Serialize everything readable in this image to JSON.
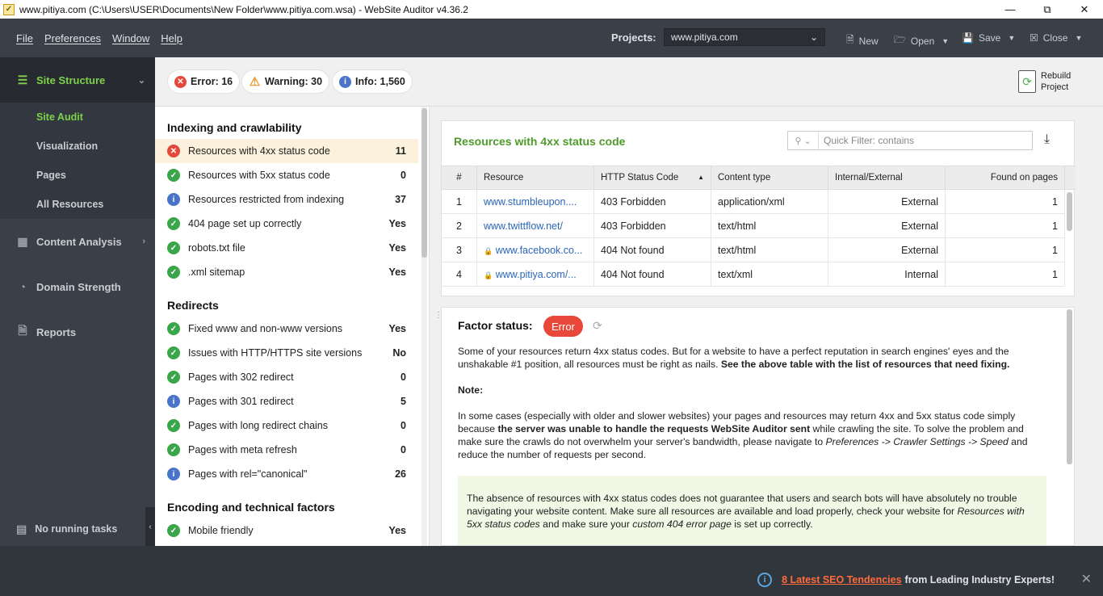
{
  "window": {
    "title": "www.pitiya.com (C:\\Users\\USER\\Documents\\New Folder\\www.pitiya.com.wsa) - WebSite Auditor v4.36.2"
  },
  "menu": [
    "File",
    "Preferences",
    "Window",
    "Help"
  ],
  "toolbar": {
    "projects_label": "Projects:",
    "project_value": "www.pitiya.com",
    "new_label": "New",
    "open_label": "Open",
    "save_label": "Save",
    "close_label": "Close"
  },
  "sidebar": {
    "site_structure": "Site Structure",
    "sub": [
      "Site Audit",
      "Visualization",
      "Pages",
      "All Resources"
    ],
    "content_analysis": "Content Analysis",
    "domain_strength": "Domain Strength",
    "reports": "Reports",
    "tasks": "No running tasks"
  },
  "summary": {
    "error": "Error: 16",
    "warning": "Warning: 30",
    "info": "Info: 1,560"
  },
  "rebuild": {
    "line1": "Rebuild",
    "line2": "Project"
  },
  "groups": [
    {
      "title": "Indexing and crawlability",
      "items": [
        {
          "label": "Resources with 4xx status code",
          "value": "11",
          "status": "err"
        },
        {
          "label": "Resources with 5xx status code",
          "value": "0",
          "status": "ok"
        },
        {
          "label": "Resources restricted from indexing",
          "value": "37",
          "status": "info"
        },
        {
          "label": "404 page set up correctly",
          "value": "Yes",
          "status": "ok"
        },
        {
          "label": "robots.txt file",
          "value": "Yes",
          "status": "ok"
        },
        {
          "label": ".xml sitemap",
          "value": "Yes",
          "status": "ok"
        }
      ]
    },
    {
      "title": "Redirects",
      "items": [
        {
          "label": "Fixed www and non-www versions",
          "value": "Yes",
          "status": "ok"
        },
        {
          "label": "Issues with HTTP/HTTPS site versions",
          "value": "No",
          "status": "ok"
        },
        {
          "label": "Pages with 302 redirect",
          "value": "0",
          "status": "ok"
        },
        {
          "label": "Pages with 301 redirect",
          "value": "5",
          "status": "info"
        },
        {
          "label": "Pages with long redirect chains",
          "value": "0",
          "status": "ok"
        },
        {
          "label": "Pages with meta refresh",
          "value": "0",
          "status": "ok"
        },
        {
          "label": "Pages with rel=\"canonical\"",
          "value": "26",
          "status": "info"
        }
      ]
    },
    {
      "title": "Encoding and technical factors",
      "items": [
        {
          "label": "Mobile friendly",
          "value": "Yes",
          "status": "ok"
        }
      ]
    }
  ],
  "table": {
    "title": "Resources with 4xx status code",
    "filter_placeholder": "Quick Filter: contains",
    "headers": [
      "#",
      "Resource",
      "HTTP Status Code",
      "Content type",
      "Internal/External",
      "Found on pages"
    ],
    "rows": [
      {
        "n": "1",
        "resource": "www.stumbleupon....",
        "lock": false,
        "code": "403 Forbidden",
        "type": "application/xml",
        "ie": "External",
        "found": "1"
      },
      {
        "n": "2",
        "resource": "www.twittflow.net/",
        "lock": false,
        "code": "403 Forbidden",
        "type": "text/html",
        "ie": "External",
        "found": "1"
      },
      {
        "n": "3",
        "resource": "www.facebook.co...",
        "lock": true,
        "code": "404 Not found",
        "type": "text/html",
        "ie": "External",
        "found": "1"
      },
      {
        "n": "4",
        "resource": "www.pitiya.com/...",
        "lock": true,
        "code": "404 Not found",
        "type": "text/xml",
        "ie": "Internal",
        "found": "1"
      }
    ]
  },
  "factor": {
    "title": "Factor status:",
    "badge": "Error",
    "p1_a": "Some of your resources return 4xx status codes. But for a website to have a perfect reputation in search engines' eyes and the unshakable #1 position, all resources must be right as nails. ",
    "p1_b": "See the above table with the list of resources that need fixing.",
    "note": "Note:",
    "p2_a": "In some cases (especially with older and slower websites) your pages and resources may return 4xx and 5xx status code simply because ",
    "p2_b": "the server was unable to handle the requests WebSite Auditor sent",
    "p2_c": " while crawling the site. To solve the problem and make sure the crawls do not overwhelm your server's bandwidth, please navigate to ",
    "p2_d": "Preferences -> Crawler Settings -> Speed",
    "p2_e": " and reduce the number of requests per second.",
    "tip_a": "The absence of resources with 4xx status codes does not guarantee that users and search bots will have absolutely no trouble navigating your website content. Make sure all resources are available and load properly, check your website for ",
    "tip_b": "Resources with 5xx status codes",
    "tip_c": " and make sure your ",
    "tip_d": "custom 404 error page",
    "tip_e": " is set up correctly."
  },
  "footer": {
    "link": "8 Latest SEO Tendencies",
    "rest": "from Leading Industry Experts!"
  }
}
